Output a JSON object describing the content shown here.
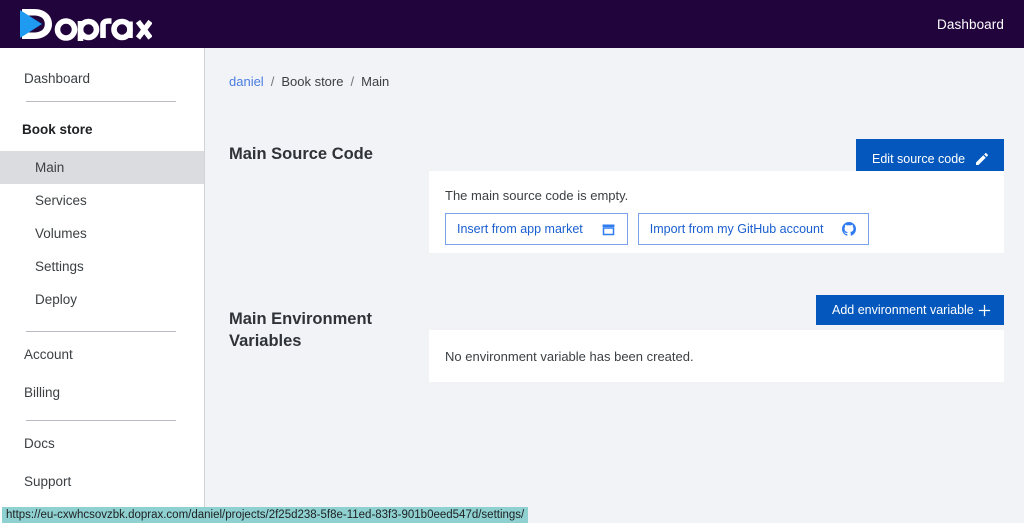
{
  "brand": {
    "name": "Doprax",
    "logo_icon": "doprax-play-logo"
  },
  "navbar": {
    "dashboard_label": "Dashboard"
  },
  "sidebar": {
    "items": [
      {
        "label": "Dashboard",
        "style": "root"
      },
      {
        "label": "Book store",
        "style": "bold"
      },
      {
        "label": "Main",
        "style": "child",
        "active": true
      },
      {
        "label": "Services",
        "style": "child"
      },
      {
        "label": "Volumes",
        "style": "child"
      },
      {
        "label": "Settings",
        "style": "child"
      },
      {
        "label": "Deploy",
        "style": "child"
      },
      {
        "label": "Account",
        "style": "root"
      },
      {
        "label": "Billing",
        "style": "root"
      },
      {
        "label": "Docs",
        "style": "root"
      },
      {
        "label": "Support",
        "style": "root"
      }
    ]
  },
  "breadcrumb": {
    "user": "daniel",
    "project": "Book store",
    "page": "Main",
    "separator": "/"
  },
  "source_section": {
    "title": "Main Source Code",
    "edit_button": {
      "label": "Edit source code",
      "icon": "pencil-icon"
    },
    "empty_text": "The main source code is empty.",
    "app_market_button": {
      "label": "Insert from app market",
      "icon": "store-icon"
    },
    "github_button": {
      "label": "Import from my GitHub account",
      "icon": "github-icon"
    }
  },
  "env_section": {
    "title": "Main Environment Variables",
    "add_button": {
      "label": "Add environment variable",
      "icon": "plus-icon"
    },
    "empty_text": "No environment variable has been created."
  },
  "status_bar": {
    "url": "https://eu-cxwhcsovzbk.doprax.com/daniel/projects/2f25d238-5f8e-11ed-83f3-901b0eed547d/settings/"
  },
  "colors": {
    "navbar": "#22043c",
    "accent_blue": "#0458bd",
    "link_blue": "#4a7ce0",
    "logo_blue": "#1e9bf0",
    "page_bg": "#f1f3f7",
    "status_bar": "#8fd1d1"
  }
}
